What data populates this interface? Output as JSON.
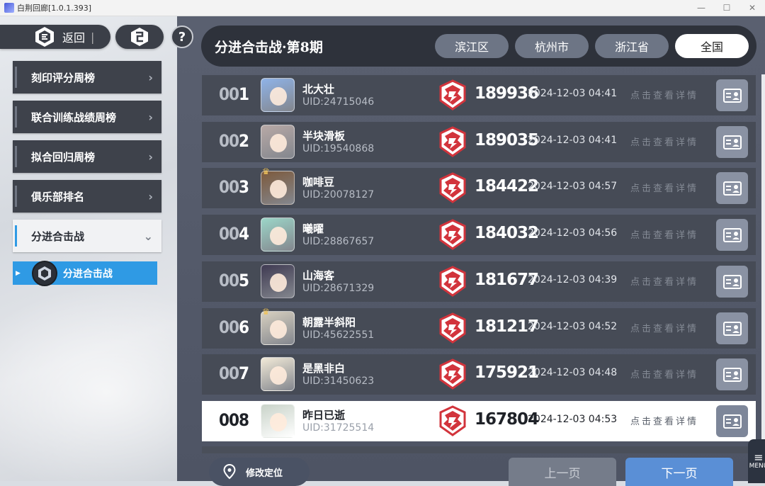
{
  "window": {
    "title": "白荆回廊[1.0.1.393]",
    "controls": [
      "—",
      "☐",
      "✕"
    ]
  },
  "nav": {
    "back_label": "返回",
    "back_sep": "|",
    "help_label": "?"
  },
  "menu": {
    "items": [
      {
        "label": "刻印评分周榜"
      },
      {
        "label": "联合训练战绩周榜"
      },
      {
        "label": "拟合回归周榜"
      },
      {
        "label": "俱乐部排名"
      },
      {
        "label": "分进合击战"
      }
    ],
    "sub_item": "分进合击战",
    "chevron": "›",
    "chevron_open": "⌄"
  },
  "location_button": "修改定位",
  "header": {
    "title": "分进合击战·第8期",
    "filters": [
      {
        "label": "滨江区",
        "active": false
      },
      {
        "label": "杭州市",
        "active": false
      },
      {
        "label": "浙江省",
        "active": false
      },
      {
        "label": "全国",
        "active": true
      }
    ]
  },
  "rows": [
    {
      "rank_prefix": "00",
      "rank_last": "1",
      "name": "北大壮",
      "uid": "UID:24715046",
      "score": "189936",
      "time": "2024-12-03 04:41",
      "detail": "点击查看详情",
      "crown": false,
      "avatar_color": "#8fb3e8"
    },
    {
      "rank_prefix": "00",
      "rank_last": "2",
      "name": "半块滑板",
      "uid": "UID:19540868",
      "score": "189035",
      "time": "2024-12-03 04:41",
      "detail": "点击查看详情",
      "crown": false,
      "avatar_color": "#b8a9a6"
    },
    {
      "rank_prefix": "00",
      "rank_last": "3",
      "name": "咖啡豆",
      "uid": "UID:20078127",
      "score": "184422",
      "time": "2024-12-03 04:57",
      "detail": "点击查看详情",
      "crown": true,
      "avatar_color": "#7d5a3c"
    },
    {
      "rank_prefix": "00",
      "rank_last": "4",
      "name": "曦曜",
      "uid": "UID:28867657",
      "score": "184032",
      "time": "2024-12-03 04:56",
      "detail": "点击查看详情",
      "crown": false,
      "avatar_color": "#9cd6c8"
    },
    {
      "rank_prefix": "00",
      "rank_last": "5",
      "name": "山海客",
      "uid": "UID:28671329",
      "score": "181677",
      "time": "2024-12-03 04:39",
      "detail": "点击查看详情",
      "crown": false,
      "avatar_color": "#3f3a52"
    },
    {
      "rank_prefix": "00",
      "rank_last": "6",
      "name": "朝露半斜阳",
      "uid": "UID:45622551",
      "score": "181217",
      "time": "2024-12-03 04:52",
      "detail": "点击查看详情",
      "crown": true,
      "avatar_color": "#d8d0c0"
    },
    {
      "rank_prefix": "00",
      "rank_last": "7",
      "name": "是黑非白",
      "uid": "UID:31450623",
      "score": "175921",
      "time": "2024-12-03 04:48",
      "detail": "点击查看详情",
      "crown": false,
      "avatar_color": "#f2ead8"
    },
    {
      "rank_prefix": "00",
      "rank_last": "8",
      "name": "昨日已逝",
      "uid": "UID:31725514",
      "score": "167804",
      "time": "2024-12-03 04:53",
      "detail": "点击查看详情",
      "crown": false,
      "avatar_color": "#c9d3c9",
      "highlight": true
    }
  ],
  "pagination": {
    "prev": "上一页",
    "next": "下一页"
  },
  "corner_menu": "MENU",
  "colors": {
    "accent_blue": "#2f9ae4",
    "emblem_red": "#d2343c",
    "next_button": "#5a8fd6"
  }
}
